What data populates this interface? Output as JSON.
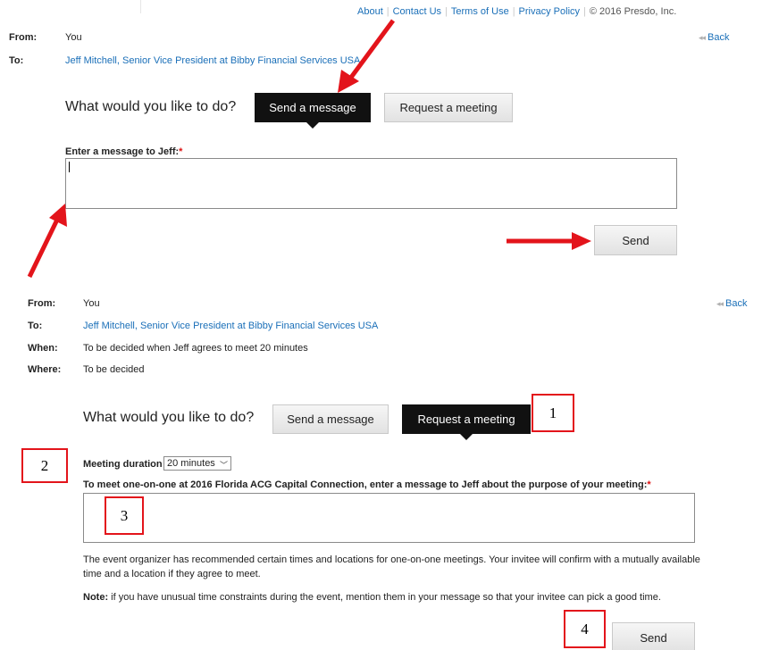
{
  "header": {
    "links": [
      "About",
      "Contact Us",
      "Terms of Use",
      "Privacy Policy"
    ],
    "copyright": "© 2016 Presdo, Inc."
  },
  "panel1": {
    "from_label": "From:",
    "from_value": "You",
    "to_label": "To:",
    "to_value": "Jeff Mitchell, Senior Vice President at Bibby Financial Services USA",
    "back_label": "Back",
    "question": "What would you like to do?",
    "tab_send_message": "Send a message",
    "tab_request_meeting": "Request a meeting",
    "message_label": "Enter a message to Jeff:",
    "required_mark": "*",
    "send_label": "Send"
  },
  "panel2": {
    "from_label": "From:",
    "from_value": "You",
    "to_label": "To:",
    "to_value": "Jeff Mitchell, Senior Vice President at Bibby Financial Services USA",
    "when_label": "When:",
    "when_value": "To be decided when Jeff agrees to meet 20 minutes",
    "where_label": "Where:",
    "where_value": "To be decided",
    "back_label": "Back",
    "question": "What would you like to do?",
    "tab_send_message": "Send a message",
    "tab_request_meeting": "Request a meeting",
    "duration_label": "Meeting duration",
    "duration_value": "20 minutes",
    "purpose_label": "To meet one-on-one at 2016 Florida ACG Capital Connection, enter a message to Jeff about the purpose of your meeting:",
    "required_mark": "*",
    "info_text": "The event organizer has recommended certain times and locations for one-on-one meetings. Your invitee will confirm with a mutually available time and a location if they agree to meet.",
    "note_label": "Note:",
    "note_text": " if you have unusual time constraints during the event, mention them in your message so that your invitee can pick a good time.",
    "send_label": "Send"
  },
  "annotations": {
    "box1": "1",
    "box2": "2",
    "box3": "3",
    "box4": "4",
    "color": "#e3141b"
  }
}
